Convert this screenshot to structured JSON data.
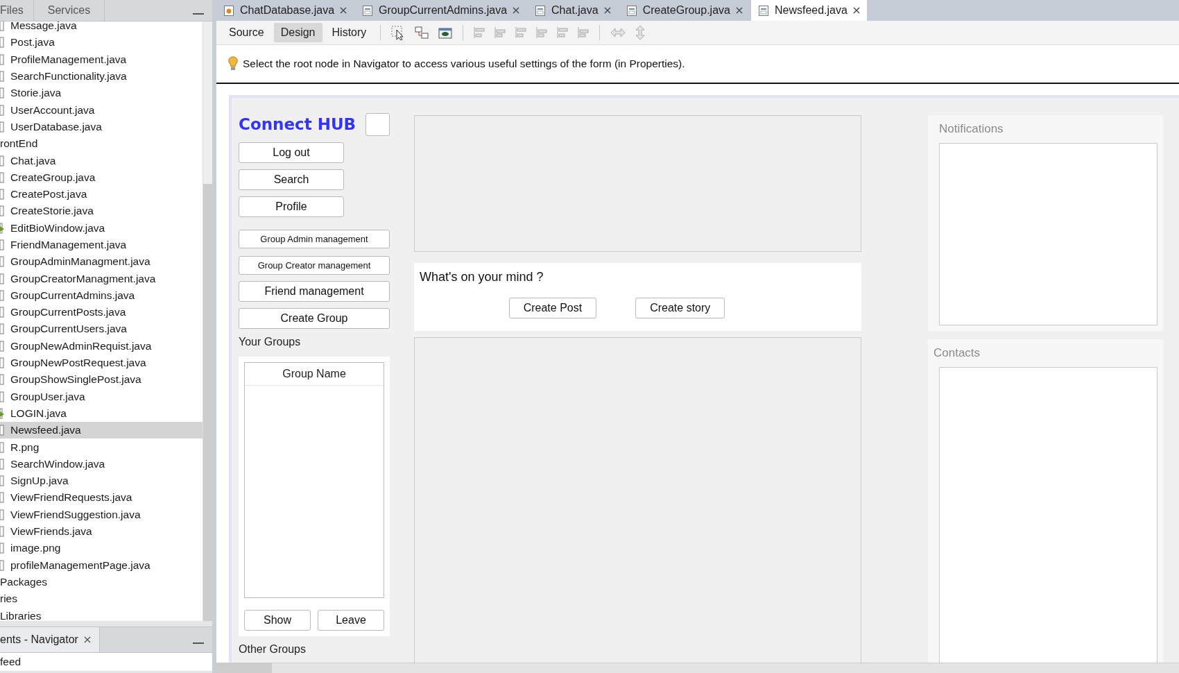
{
  "project_panel": {
    "tabs": [
      {
        "label": "Files",
        "selected": false
      },
      {
        "label": "Services",
        "selected": false
      }
    ],
    "cut_off_files": [
      {
        "label": "Message.java",
        "kind": "java",
        "selected": false
      },
      {
        "label": "Post.java",
        "kind": "java",
        "selected": false
      },
      {
        "label": "ProfileManagement.java",
        "kind": "java",
        "selected": false
      },
      {
        "label": "SearchFunctionality.java",
        "kind": "java",
        "selected": false
      },
      {
        "label": "Storie.java",
        "kind": "java",
        "selected": false
      },
      {
        "label": "UserAccount.java",
        "kind": "java",
        "selected": false
      },
      {
        "label": "UserDatabase.java",
        "kind": "java",
        "selected": false
      }
    ],
    "tree": [
      {
        "label": "rontEnd",
        "kind": "folder",
        "selected": false,
        "children": [
          {
            "label": "Chat.java",
            "kind": "java",
            "selected": false
          },
          {
            "label": "CreateGroup.java",
            "kind": "java",
            "selected": false
          },
          {
            "label": "CreatePost.java",
            "kind": "java",
            "selected": false
          },
          {
            "label": "CreateStorie.java",
            "kind": "java",
            "selected": false
          },
          {
            "label": "EditBioWindow.java",
            "kind": "main",
            "selected": false
          },
          {
            "label": "FriendManagement.java",
            "kind": "java",
            "selected": false
          },
          {
            "label": "GroupAdminManagment.java",
            "kind": "java",
            "selected": false
          },
          {
            "label": "GroupCreatorManagment.java",
            "kind": "java",
            "selected": false
          },
          {
            "label": "GroupCurrentAdmins.java",
            "kind": "java",
            "selected": false
          },
          {
            "label": "GroupCurrentPosts.java",
            "kind": "java",
            "selected": false
          },
          {
            "label": "GroupCurrentUsers.java",
            "kind": "java",
            "selected": false
          },
          {
            "label": "GroupNewAdminRequist.java",
            "kind": "java",
            "selected": false
          },
          {
            "label": "GroupNewPostRequest.java",
            "kind": "java",
            "selected": false
          },
          {
            "label": "GroupShowSinglePost.java",
            "kind": "java",
            "selected": false
          },
          {
            "label": "GroupUser.java",
            "kind": "java",
            "selected": false
          },
          {
            "label": "LOGIN.java",
            "kind": "main",
            "selected": false
          },
          {
            "label": "Newsfeed.java",
            "kind": "java",
            "selected": true
          },
          {
            "label": "R.png",
            "kind": "image",
            "selected": false
          },
          {
            "label": "SearchWindow.java",
            "kind": "java",
            "selected": false
          },
          {
            "label": "SignUp.java",
            "kind": "java",
            "selected": false
          },
          {
            "label": "ViewFriendRequests.java",
            "kind": "java",
            "selected": false
          },
          {
            "label": "ViewFriendSuggestion.java",
            "kind": "java",
            "selected": false
          },
          {
            "label": "ViewFriends.java",
            "kind": "java",
            "selected": false
          },
          {
            "label": "image.png",
            "kind": "image",
            "selected": false
          },
          {
            "label": "profileManagementPage.java",
            "kind": "java",
            "selected": false
          }
        ]
      },
      {
        "label": "Packages",
        "kind": "folder",
        "selected": false
      },
      {
        "label": "ries",
        "kind": "folder",
        "selected": false
      },
      {
        "label": "Libraries",
        "kind": "folder",
        "selected": false
      }
    ]
  },
  "navigator_panel": {
    "tab": "ents - Navigator",
    "node": "feed"
  },
  "editor_tabs": [
    {
      "label": "ChatDatabase.java",
      "kind": "class",
      "selected": false
    },
    {
      "label": "GroupCurrentAdmins.java",
      "kind": "form",
      "selected": false
    },
    {
      "label": "Chat.java",
      "kind": "form",
      "selected": false
    },
    {
      "label": "CreateGroup.java",
      "kind": "form",
      "selected": false
    },
    {
      "label": "Newsfeed.java",
      "kind": "form",
      "selected": true
    }
  ],
  "toolbar": {
    "views": [
      {
        "label": "Source",
        "selected": false
      },
      {
        "label": "Design",
        "selected": true
      },
      {
        "label": "History",
        "selected": false
      }
    ]
  },
  "info_message": "Select the root node in Navigator to access various useful settings of the form (in Properties).",
  "form": {
    "title": "Connect HUB",
    "nav_buttons": [
      "Log out",
      "Search",
      "Profile"
    ],
    "group_buttons": [
      "Group Admin management",
      "Group Creator management"
    ],
    "action_buttons": [
      "Friend management",
      "Create Group"
    ],
    "your_groups_label": "Your Groups",
    "groups_table": {
      "columns": [
        "Group Name"
      ]
    },
    "group_actions": [
      "Show",
      "Leave"
    ],
    "other_groups_label": "Other Groups",
    "post_prompt": "What's on your mind ?",
    "post_buttons": [
      "Create Post",
      "Create story"
    ],
    "notifications_title": "Notifications",
    "contacts_title": "Contacts"
  }
}
